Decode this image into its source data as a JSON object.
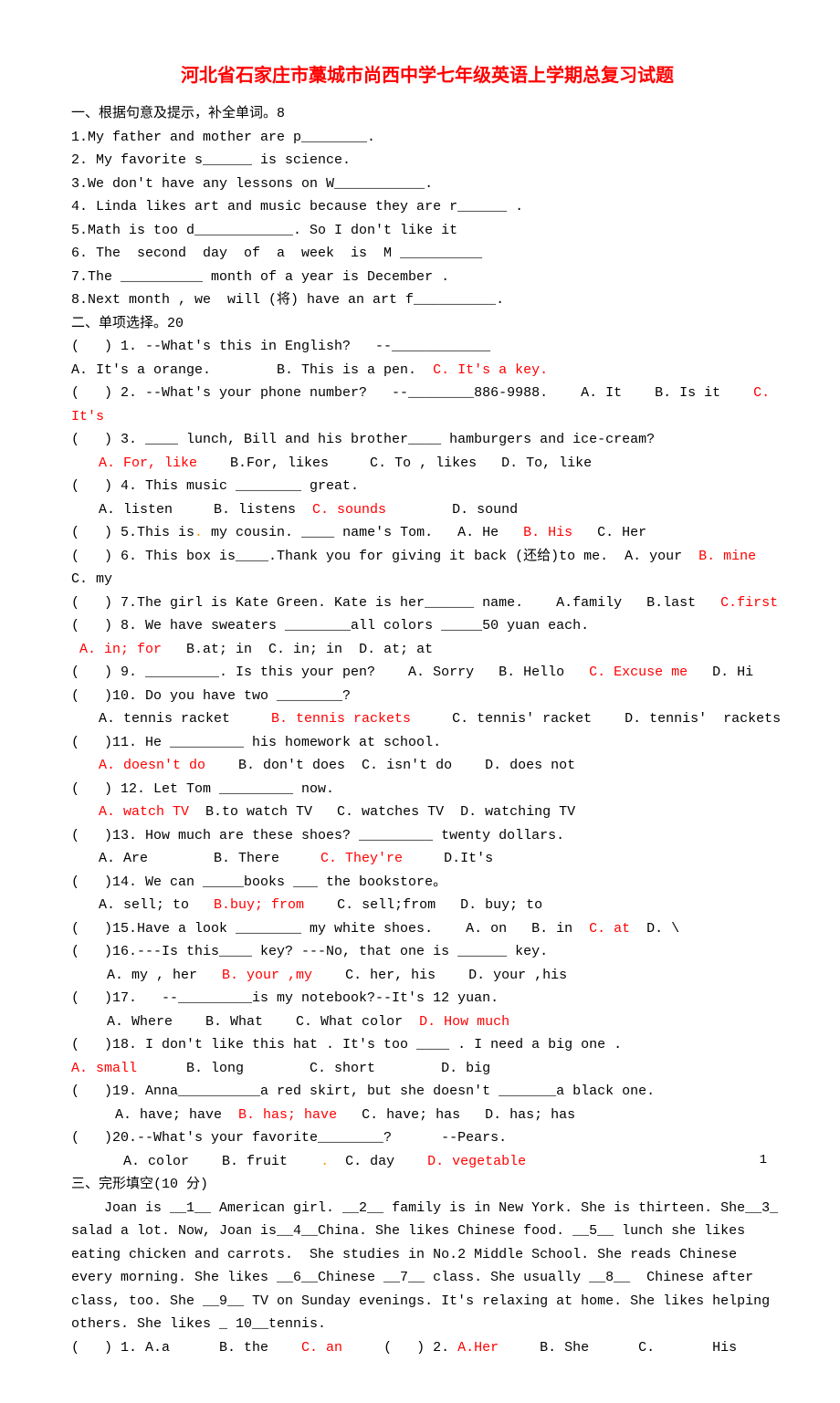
{
  "title": "河北省石家庄市藁城市尚西中学七年级英语上学期总复习试题",
  "section1": {
    "heading": "一、根据句意及提示，补全单词。8",
    "q1": "1.My father and mother are p________.",
    "q2": "2. My favorite s______ is science.",
    "q3": "3.We don't have any lessons on W___________.",
    "q4": "4. Linda likes art and music because they are r______ .",
    "q5": "5.Math is too d____________. So I don't like it",
    "q6": "6. The  second  day  of  a  week  is  M __________",
    "q7": "7.The __________ month of a year is December .",
    "q8": "8.Next month , we  will (将) have an art f__________."
  },
  "section2": {
    "heading": "二、单项选择。20",
    "q1a": "(   ) 1. --What's this in English?   --____________",
    "q1b_pre": "A. It's a orange.        B. This is a pen.  ",
    "q1b_ans": "C. It's a key.",
    "q2_pre": "(   ) 2. --What's your phone number?   --________886-9988.    A. It    B. Is it    ",
    "q2_ans": "C. It's",
    "q3a": "(   ) 3. ____ lunch, Bill and his brother____ hamburgers and ice-cream?",
    "q3b_ans": "A. For, like",
    "q3b_post": "    B.For, likes     C. To , likes   D. To, like",
    "q4a": "(   ) 4. This music ________ great.",
    "q4b_pre": "A. listen     B. listens  ",
    "q4b_ans": "C. sounds",
    "q4b_post": "        D. sound",
    "q5_pre": "(   ) 5.This is",
    "q5_mid": " my cousin. ____ name's Tom.   A. He   ",
    "q5_ans": "B. His",
    "q5_post": "   C. Her",
    "q6_pre": "(   ) 6. This box is____.Thank you for giving it back (还给)to me.  A. your  ",
    "q6_ans": "B. mine",
    "q6_post": "  C. my",
    "q7_pre": "(   ) 7.The girl is Kate Green. Kate is her______ name.    A.family   B.last   ",
    "q7_ans": "C.first",
    "q8a": "(   ) 8. We have sweaters ________all colors _____50 yuan each.",
    "q8b_ans": "A. in; for",
    "q8b_post": "   B.at; in  C. in; in  D. at; at",
    "q9_pre": "(   ) 9. _________. Is this your pen?    A. Sorry   B. Hello   ",
    "q9_ans": "C. Excuse me",
    "q9_post": "   D. Hi",
    "q10a": "(   )10. Do you have two ________?",
    "q10b_pre": "A. tennis racket     ",
    "q10b_ans": "B. tennis rackets",
    "q10b_post": "     C. tennis' racket    D. tennis'  rackets",
    "q11a": "(   )11. He _________ his homework at school.",
    "q11b_ans": "A. doesn't do",
    "q11b_post": "    B. don't does  C. isn't do    D. does not",
    "q12a": "(   ) 12. Let Tom _________ now.",
    "q12b_ans": "A. watch TV",
    "q12b_post": "  B.to watch TV   C. watches TV  D. watching TV",
    "q13a": "(   )13. How much are these shoes? _________ twenty dollars.",
    "q13b_pre": "A. Are        B. There     ",
    "q13b_ans": "C. They're",
    "q13b_post": "     D.It's",
    "q14a": "(   )14. We can _____books ___ the bookstore。",
    "q14b_pre": "A. sell; to   ",
    "q14b_ans": "B.buy; from",
    "q14b_post": "    C. sell;from   D. buy; to",
    "q15_pre": "(   )15.Have a look ________ my white shoes.    A. on   B. in  ",
    "q15_ans": "C. at",
    "q15_post": "  D. \\",
    "q16a": "(   )16.---Is this____ key? ---No, that one is ______ key.",
    "q16b_pre": " A. my , her   ",
    "q16b_ans": "B. your ,my",
    "q16b_post": "    C. her, his    D. your ,his",
    "q17a": "(   )17.   --_________is my notebook?--It's 12 yuan.",
    "q17b_pre": " A. Where    B. What    C. What color  ",
    "q17b_ans": "D. How much",
    "q18a": "(   )18. I don't like this hat . It's too ____ . I need a big one .",
    "q18b_ans": "A. small",
    "q18b_post": "      B. long        C. short        D. big",
    "q19a": "(   )19. Anna__________a red skirt, but she doesn't _______a black one.",
    "q19b_pre": "  A. have; have  ",
    "q19b_ans": "B. has; have",
    "q19b_post": "   C. have; has   D. has; has",
    "q20a": "(   )20.--What's your favorite________?      --Pears.",
    "q20b_pre": "   A. color    B. fruit    ",
    "q20b_mid": "  C. day    ",
    "q20b_ans": "D. vegetable"
  },
  "section3": {
    "heading": "三、完形填空(10 分)",
    "p1": "    Joan is __1__ American girl. __2__ family is in New York. She is thirteen. She__3_ salad a lot. Now, Joan is__4__China. She likes Chinese food. __5__ lunch she likes eating chicken and carrots.  She studies in No.2 Middle School. She reads Chinese every morning. She likes __6__Chinese __7__ class. She usually __8__  Chinese after class, too. She __9__ TV on Sunday evenings. It's relaxing at home. She likes helping others. She likes _ 10__tennis.",
    "opts_pre": "(   ) 1. A.a      B. the    ",
    "opt1_ans": "C. an",
    "opts_mid": "     (   ) 2. ",
    "opt2_ans": "A.Her",
    "opts_post": "     B. She      C.       His"
  },
  "page_num": "1"
}
